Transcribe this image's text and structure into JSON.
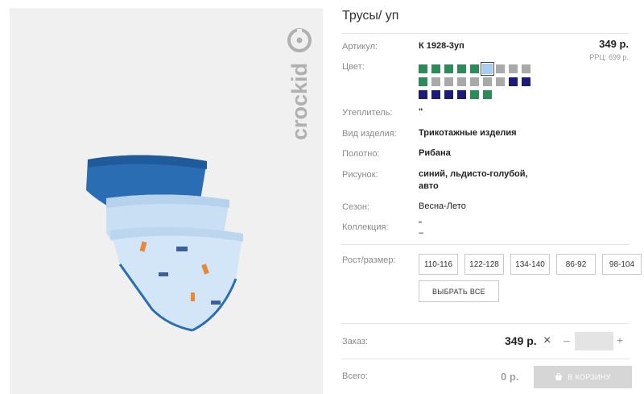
{
  "product": {
    "title": "Трусы/ уп",
    "brand": "crockid"
  },
  "attributes": {
    "article_label": "Артикул:",
    "article_value": "К 1928-3уп",
    "color_label": "Цвет:",
    "insulation_label": "Утеплитель:",
    "insulation_value": "\"",
    "type_label": "Вид изделия:",
    "type_value": "Трикотажные изделия",
    "fabric_label": "Полотно:",
    "fabric_value": "Рибана",
    "pattern_label": "Рисунок:",
    "pattern_value_line1": "синий, льдисто-голубой,",
    "pattern_value_line2": "авто",
    "season_label": "Сезон:",
    "season_value": "Весна-Лето",
    "collection_label": "Коллекция:",
    "collection_value_line1": "\"",
    "collection_value_line2": "–",
    "size_label": "Рост/размер:"
  },
  "pricing": {
    "price": "349 р.",
    "rrp": "РРЦ: 699 р."
  },
  "swatches": {
    "colors": {
      "green": "#2f8a5a",
      "gray": "#a9a9a9",
      "navy": "#1c1c78",
      "lightblue": "#a9cdf2"
    },
    "rows": [
      [
        "green",
        "green",
        "green",
        "green",
        "green",
        "lightblue",
        "gray",
        "gray",
        "gray"
      ],
      [
        "green",
        "gray",
        "gray",
        "gray",
        "gray",
        "gray",
        "gray",
        "navy",
        "navy"
      ],
      [
        "navy",
        "navy",
        "navy",
        "navy",
        "green",
        "green"
      ]
    ],
    "selected": [
      0,
      5
    ]
  },
  "sizes": [
    "110-116",
    "122-128",
    "134-140",
    "86-92",
    "98-104"
  ],
  "select_all_label": "ВЫБРАТЬ ВСЕ",
  "order": {
    "label": "Заказ:",
    "price": "349 р.",
    "minus": "–",
    "plus": "+",
    "quantity": ""
  },
  "total": {
    "label": "Всего:",
    "value": "0 р.",
    "cart_button": "В КОРЗИНУ"
  }
}
